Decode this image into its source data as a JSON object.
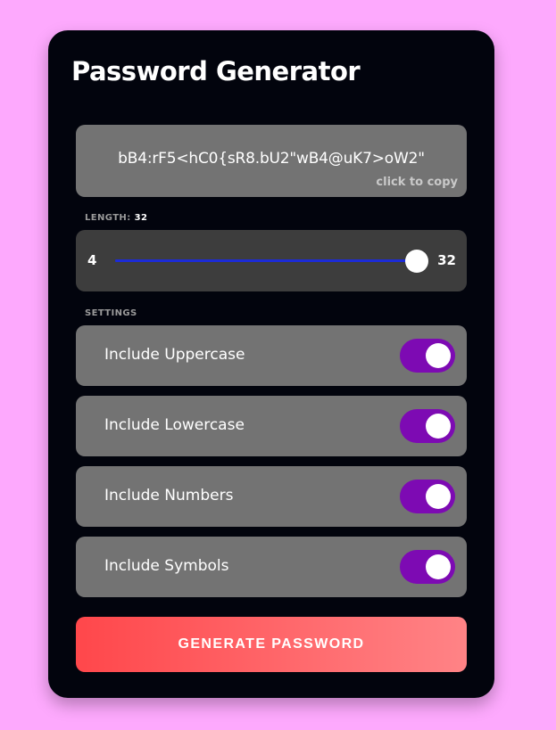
{
  "app": {
    "title": "Password Generator"
  },
  "result": {
    "password": "bB4:rF5<hC0{sR8.bU2\"wB4@uK7>oW2\"",
    "copy_hint": "click to copy"
  },
  "length": {
    "label": "LENGTH:",
    "value": "32",
    "min": "4",
    "max": "32",
    "slider_fraction": 1.0
  },
  "settings": {
    "label": "SETTINGS",
    "items": [
      {
        "label": "Include Uppercase",
        "checked": true
      },
      {
        "label": "Include Lowercase",
        "checked": true
      },
      {
        "label": "Include Numbers",
        "checked": true
      },
      {
        "label": "Include Symbols",
        "checked": true
      }
    ]
  },
  "generate": {
    "label": "GENERATE PASSWORD"
  },
  "colors": {
    "page_background": "#fda9fd",
    "card_background": "#02040d",
    "panel_gray": "#737373",
    "slider_panel": "#3d3d3d",
    "slider_track": "#1c2bd6",
    "toggle_on": "#7d0ab3",
    "button_gradient_start": "#ff474b",
    "button_gradient_end": "#ff8386"
  }
}
